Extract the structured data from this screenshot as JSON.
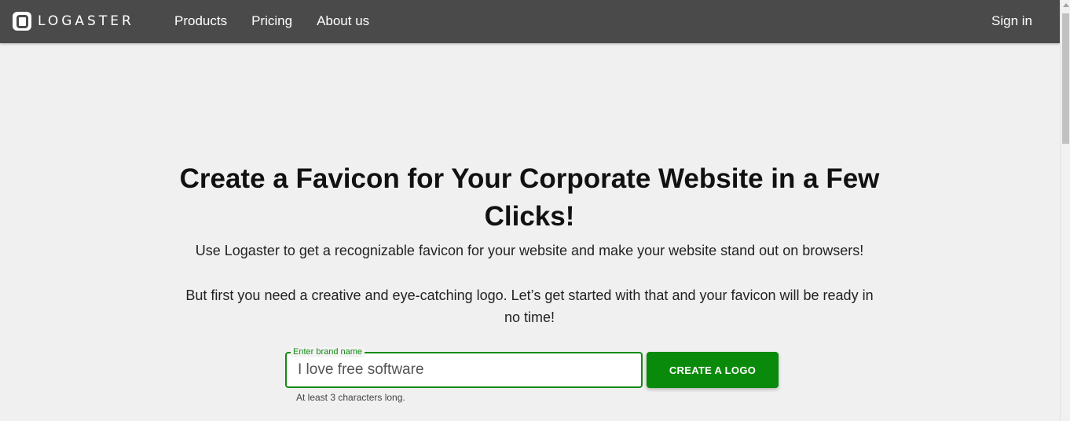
{
  "header": {
    "logo_text": "LOGASTER",
    "nav": [
      {
        "label": "Products"
      },
      {
        "label": "Pricing"
      },
      {
        "label": "About us"
      }
    ],
    "signin_label": "Sign in"
  },
  "hero": {
    "title": "Create a Favicon for Your Corporate Website in a Few Clicks!",
    "subtitle": "Use Logaster to get a recognizable favicon for your website and make your website stand out on browsers!",
    "body": "But first you need a creative and eye-catching logo. Let’s get started with that and your favicon will be ready in no time!"
  },
  "form": {
    "field_label": "Enter brand name",
    "input_value": "I love free software",
    "helper_text": "At least 3 characters long.",
    "cta_label": "CREATE A LOGO"
  },
  "colors": {
    "header_bg": "#4a4a4a",
    "accent_green": "#0a8a0a",
    "page_bg": "#f0f0f0"
  }
}
